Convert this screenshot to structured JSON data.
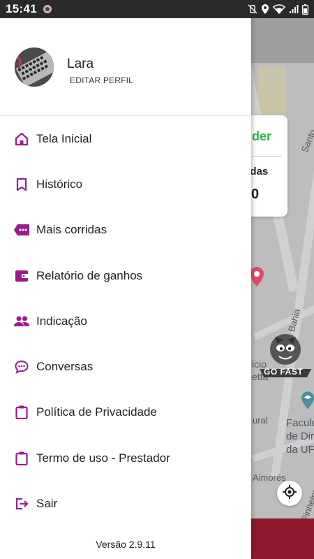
{
  "status_bar": {
    "time": "15:41"
  },
  "profile": {
    "name": "Lara",
    "edit_label": "EDITAR PERFIL"
  },
  "menu": [
    {
      "label": "Tela Inicial",
      "icon": "home-icon"
    },
    {
      "label": "Histórico",
      "icon": "bookmark-icon"
    },
    {
      "label": "Mais corridas",
      "icon": "more-rides-tag-icon"
    },
    {
      "label": "Relatório de ganhos",
      "icon": "wallet-icon"
    },
    {
      "label": "Indicação",
      "icon": "people-icon"
    },
    {
      "label": "Conversas",
      "icon": "chat-icon"
    },
    {
      "label": "Política de Privacidade",
      "icon": "clipboard-icon"
    },
    {
      "label": "Termo de uso - Prestador",
      "icon": "clipboard-icon"
    },
    {
      "label": "Sair",
      "icon": "exit-icon"
    }
  ],
  "version": "Versão 2.9.11",
  "map": {
    "card_status": "nder",
    "card_label": "adas",
    "card_count": "0",
    "street_1": "Santo",
    "street_2": "a Bahia",
    "street_3": "Aimorés",
    "street_4": "Pinheiro",
    "street_5": "ural",
    "poi_1": "icio",
    "poi_2": "etta",
    "poi_3": "Faculd\nde Dir\nda UF",
    "mascot_text": "GO FAST"
  },
  "colors": {
    "accent": "#9c1a8e",
    "status_green": "#2bb24c",
    "bottom_strip": "#8f1a2d"
  }
}
